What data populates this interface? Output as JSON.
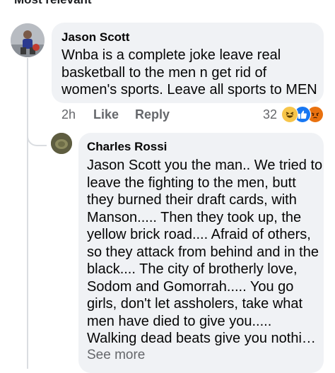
{
  "header_fragment": "Most relevant",
  "comment": {
    "author": "Jason Scott",
    "text": "Wnba is a complete joke leave real basketball to the men n get rid of women's sports. Leave all sports to MEN",
    "time": "2h",
    "like_label": "Like",
    "reply_label": "Reply",
    "reaction_count": "32",
    "reactions": [
      "haha-icon",
      "like-icon",
      "angry-icon"
    ],
    "colors": {
      "haha": "#f7c54a",
      "like": "#1877f2",
      "angry": "#e9710f"
    }
  },
  "reply": {
    "author": "Charles Rossi",
    "text": "Jason Scott you the man..  We tried to leave the fighting to the men, butt they burned their draft cards, with Manson..... Then they took up, the yellow brick road....  Afraid of others, so they attack from behind and in the black....  The city of brotherly love, Sodom and Gomorrah.....   You go girls, don't let assholers, take what men have died to give you..... Walking dead beats give you nothi…",
    "see_more_label": "See more"
  },
  "colors": {
    "bubble": "#f0f2f5",
    "meta_text": "#65676b",
    "thread_line": "#dadde1"
  }
}
